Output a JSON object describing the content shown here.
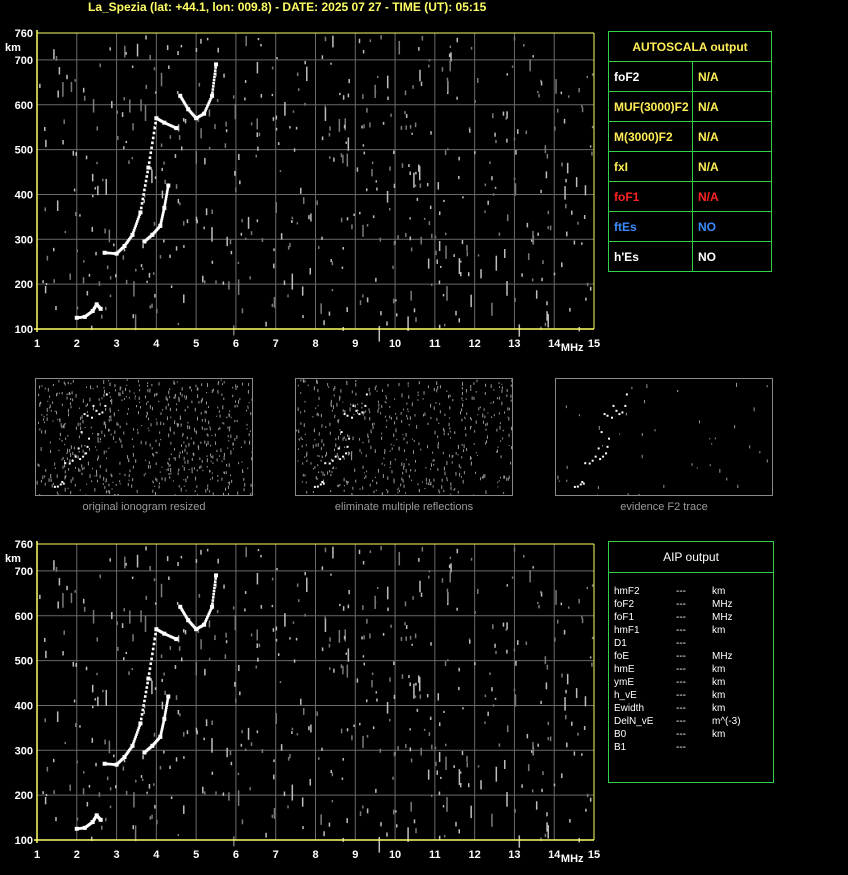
{
  "header": {
    "title": "La_Spezia (lat: +44.1, lon: 009.8) - DATE: 2025 07 27 - TIME (UT): 05:15"
  },
  "chart_data": [
    {
      "type": "scatter",
      "title": "",
      "xlabel": "MHz",
      "ylabel": "km",
      "xlim": [
        1,
        15
      ],
      "ylim": [
        100,
        760
      ],
      "x_ticks": [
        "1",
        "2",
        "3",
        "4",
        "5",
        "6",
        "7",
        "8",
        "9",
        "10",
        "11",
        "12",
        "13",
        "14",
        "15"
      ],
      "y_ticks": [
        "100",
        "200",
        "300",
        "400",
        "500",
        "600",
        "700",
        "760"
      ],
      "grid": true,
      "series": [
        {
          "values": [
            [
              2.0,
              125
            ],
            [
              2.2,
              127
            ],
            [
              2.4,
              140
            ],
            [
              2.5,
              155
            ],
            [
              2.6,
              145
            ]
          ]
        },
        {
          "values": [
            [
              2.7,
              270
            ],
            [
              3.0,
              268
            ],
            [
              3.2,
              285
            ],
            [
              3.4,
              310
            ],
            [
              3.6,
              360
            ],
            [
              3.8,
              460
            ],
            [
              4.0,
              570
            ],
            [
              4.2,
              560
            ],
            [
              4.5,
              548
            ]
          ]
        },
        {
          "values": [
            [
              3.7,
              295
            ],
            [
              3.9,
              310
            ],
            [
              4.1,
              330
            ],
            [
              4.2,
              370
            ],
            [
              4.3,
              420
            ]
          ]
        },
        {
          "values": [
            [
              4.6,
              620
            ],
            [
              4.8,
              590
            ],
            [
              5.0,
              570
            ],
            [
              5.2,
              580
            ],
            [
              5.4,
              620
            ],
            [
              5.5,
              690
            ]
          ]
        }
      ]
    },
    {
      "type": "scatter",
      "title": "",
      "xlabel": "MHz",
      "ylabel": "km",
      "xlim": [
        1,
        15
      ],
      "ylim": [
        100,
        760
      ],
      "x_ticks": [
        "1",
        "2",
        "3",
        "4",
        "5",
        "6",
        "7",
        "8",
        "9",
        "10",
        "11",
        "12",
        "13",
        "14",
        "15"
      ],
      "y_ticks": [
        "100",
        "200",
        "300",
        "400",
        "500",
        "600",
        "700",
        "760"
      ],
      "grid": true,
      "series": [
        {
          "values": [
            [
              2.0,
              125
            ],
            [
              2.2,
              127
            ],
            [
              2.4,
              140
            ],
            [
              2.5,
              155
            ],
            [
              2.6,
              145
            ]
          ]
        },
        {
          "values": [
            [
              2.7,
              270
            ],
            [
              3.0,
              268
            ],
            [
              3.2,
              285
            ],
            [
              3.4,
              310
            ],
            [
              3.6,
              360
            ],
            [
              3.8,
              460
            ],
            [
              4.0,
              570
            ],
            [
              4.2,
              560
            ],
            [
              4.5,
              548
            ]
          ]
        },
        {
          "values": [
            [
              3.7,
              295
            ],
            [
              3.9,
              310
            ],
            [
              4.1,
              330
            ],
            [
              4.2,
              370
            ],
            [
              4.3,
              420
            ]
          ]
        },
        {
          "values": [
            [
              4.6,
              620
            ],
            [
              4.8,
              590
            ],
            [
              5.0,
              570
            ],
            [
              5.2,
              580
            ],
            [
              5.4,
              620
            ],
            [
              5.5,
              690
            ]
          ]
        }
      ]
    }
  ],
  "thumbnails": [
    {
      "caption": "original ionogram resized"
    },
    {
      "caption": "eliminate multiple reflections"
    },
    {
      "caption": "evidence F2 trace"
    }
  ],
  "autoscala": {
    "title": "AUTOSCALA output",
    "rows": [
      {
        "param": "foF2",
        "value": "N/A",
        "param_color": "#ffffff",
        "value_color": "#ffee55"
      },
      {
        "param": "MUF(3000)F2",
        "value": "N/A",
        "param_color": "#ffee55",
        "value_color": "#ffee55"
      },
      {
        "param": "M(3000)F2",
        "value": "N/A",
        "param_color": "#ffee55",
        "value_color": "#ffee55"
      },
      {
        "param": "fxI",
        "value": "N/A",
        "param_color": "#ffee55",
        "value_color": "#ffee55"
      },
      {
        "param": "foF1",
        "value": "N/A",
        "param_color": "#ff2222",
        "value_color": "#ff2222"
      },
      {
        "param": "ftEs",
        "value": "NO",
        "param_color": "#3a8cff",
        "value_color": "#3a8cff"
      },
      {
        "param": "h'Es",
        "value": "NO",
        "param_color": "#ffffff",
        "value_color": "#ffffff"
      }
    ]
  },
  "aip": {
    "title": "AIP output",
    "rows": [
      {
        "name": "hmF2",
        "value": "---",
        "unit": "km"
      },
      {
        "name": "foF2",
        "value": "---",
        "unit": "MHz"
      },
      {
        "name": "foF1",
        "value": "---",
        "unit": "MHz"
      },
      {
        "name": "hmF1",
        "value": "---",
        "unit": "km"
      },
      {
        "name": "D1",
        "value": "---",
        "unit": ""
      },
      {
        "name": "foE",
        "value": "---",
        "unit": "MHz"
      },
      {
        "name": "hmE",
        "value": "---",
        "unit": "km"
      },
      {
        "name": "ymE",
        "value": "---",
        "unit": "km"
      },
      {
        "name": "h_vE",
        "value": "---",
        "unit": "km"
      },
      {
        "name": "Ewidth",
        "value": "---",
        "unit": "km"
      },
      {
        "name": "DelN_vE",
        "value": "---",
        "unit": "m^(-3)"
      },
      {
        "name": "B0",
        "value": "---",
        "unit": "km"
      },
      {
        "name": "B1",
        "value": "---",
        "unit": ""
      }
    ]
  }
}
